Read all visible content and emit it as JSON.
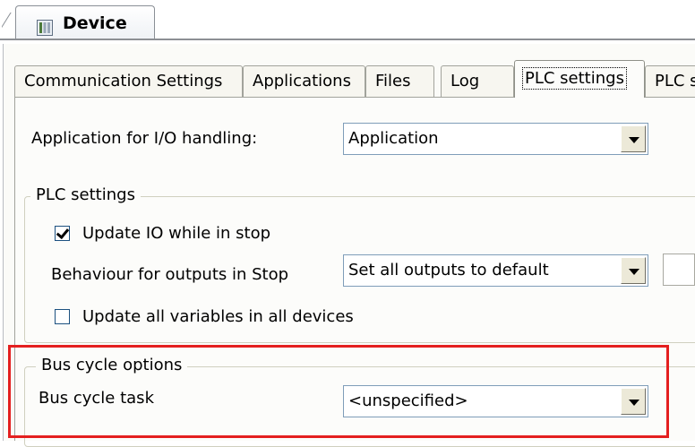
{
  "document_tab": {
    "title": "Device",
    "icon": "device-icon"
  },
  "tabs": [
    {
      "label": "Communication Settings",
      "active": false
    },
    {
      "label": "Applications",
      "active": false
    },
    {
      "label": "Files",
      "active": false
    },
    {
      "label": "Log",
      "active": false
    },
    {
      "label": "PLC settings",
      "active": true
    },
    {
      "label": "PLC s",
      "active": false
    }
  ],
  "io_handling": {
    "label": "Application for I/O handling:",
    "value": "Application"
  },
  "plc_settings": {
    "title": "PLC settings",
    "update_io": {
      "label": "Update IO while in stop",
      "checked": true
    },
    "outputs_stop": {
      "label": "Behaviour for outputs in Stop",
      "value": "Set all outputs to default"
    },
    "update_all": {
      "label": "Update all variables in all devices",
      "checked": false
    }
  },
  "bus_cycle": {
    "title": "Bus cycle options",
    "task_label": "Bus cycle task",
    "task_value": "<unspecified>"
  },
  "colors": {
    "highlight": "#e41f1f",
    "combo_border": "#7f9db9",
    "panel_bg": "#fcfcfa"
  }
}
